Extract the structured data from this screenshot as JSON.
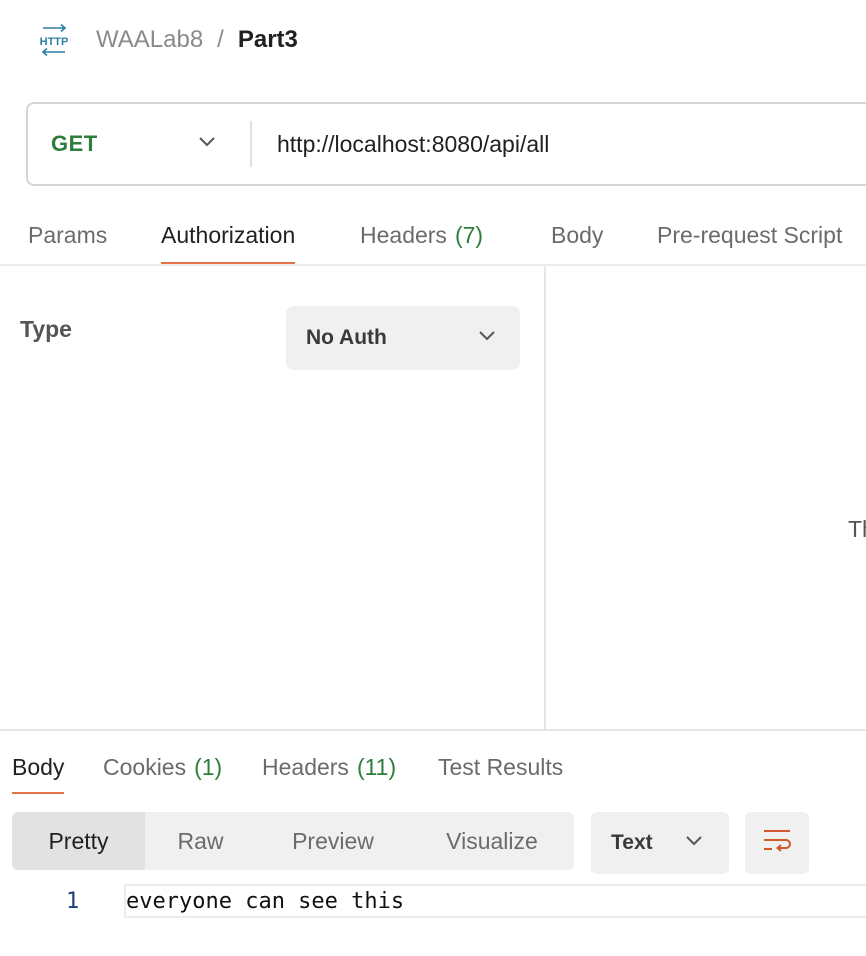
{
  "breadcrumb": {
    "icon": "http-icon",
    "collection": "WAALab8",
    "separator": "/",
    "request_name": "Part3"
  },
  "request": {
    "method": "GET",
    "url": "http://localhost:8080/api/all"
  },
  "request_tabs": [
    {
      "label": "Params"
    },
    {
      "label": "Authorization",
      "active": true
    },
    {
      "label": "Headers",
      "count": "(7)"
    },
    {
      "label": "Body"
    },
    {
      "label": "Pre-request Script"
    }
  ],
  "auth": {
    "type_label": "Type",
    "selected": "No Auth",
    "right_panel_text": "Th"
  },
  "response_tabs": [
    {
      "label": "Body",
      "active": true
    },
    {
      "label": "Cookies",
      "count": "(1)"
    },
    {
      "label": "Headers",
      "count": "(11)"
    },
    {
      "label": "Test Results"
    }
  ],
  "view_modes": [
    {
      "label": "Pretty",
      "active": true
    },
    {
      "label": "Raw"
    },
    {
      "label": "Preview"
    },
    {
      "label": "Visualize"
    }
  ],
  "format": {
    "selected": "Text"
  },
  "response_body": {
    "lines": [
      {
        "number": "1",
        "text": "everyone can see this"
      }
    ]
  },
  "colors": {
    "method_get": "#2f7d3a",
    "count_green": "#2f7d3a",
    "active_tab_underline": "#e8734a",
    "http_icon": "#2b7fa3",
    "wrap_icon": "#d0582b"
  }
}
